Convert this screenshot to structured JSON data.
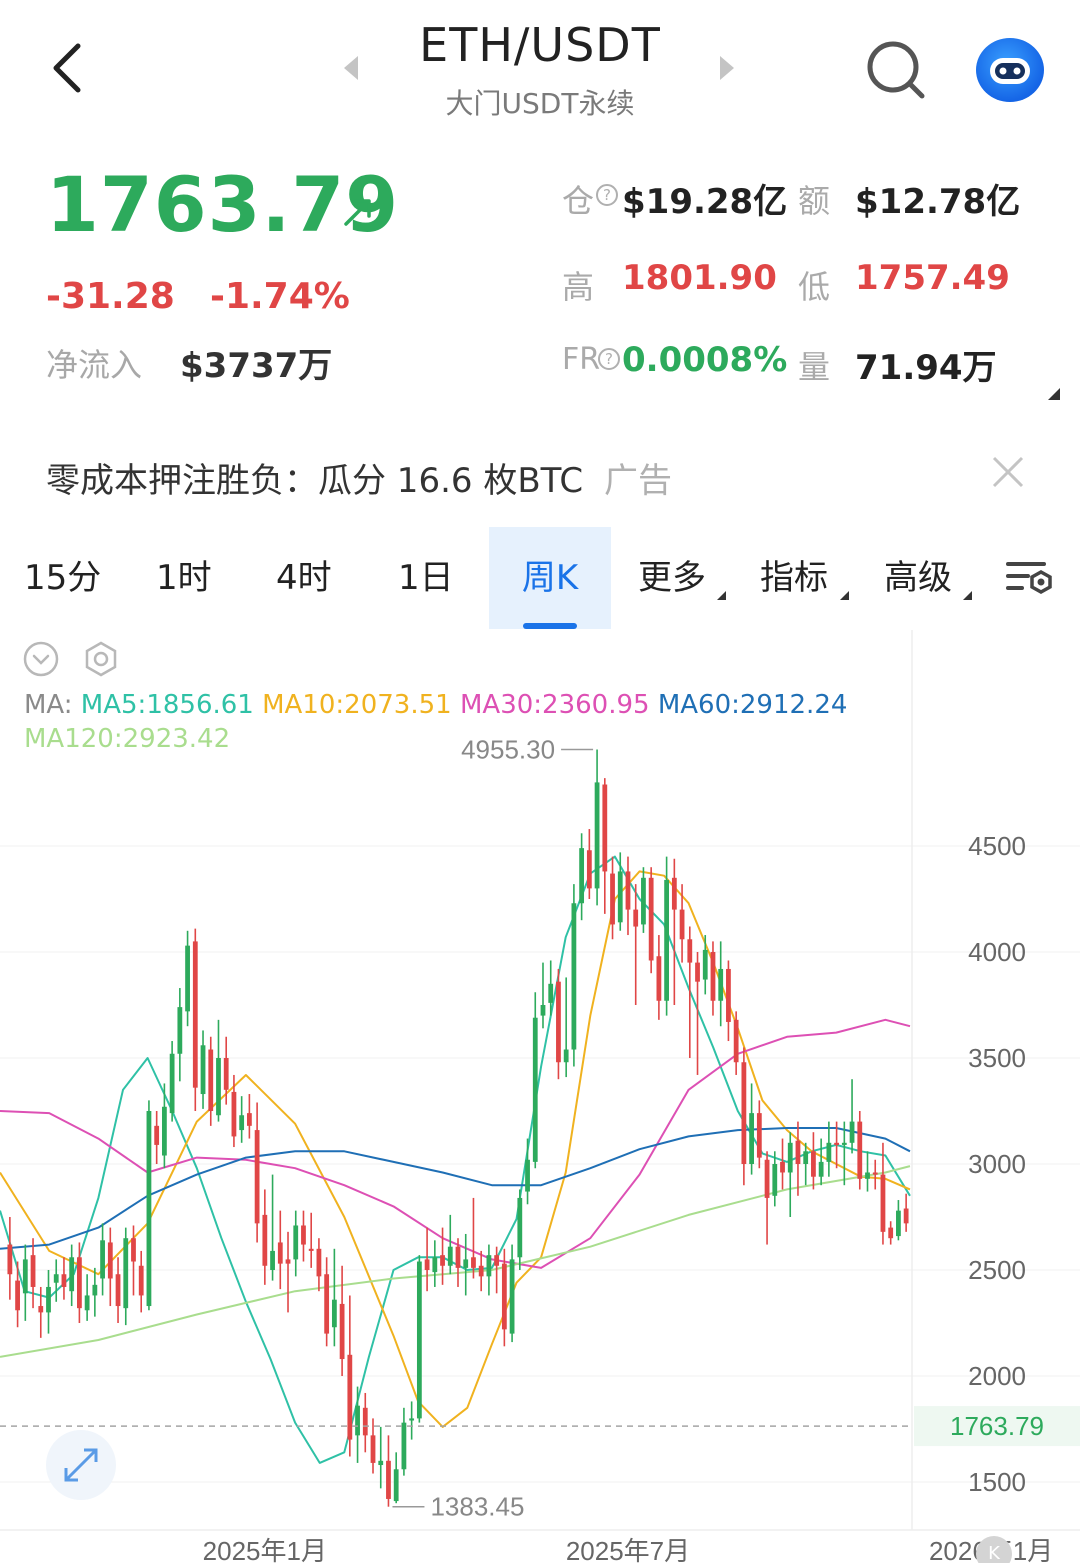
{
  "header": {
    "title": "ETH/USDT",
    "subtitle": "大门USDT永续"
  },
  "ticker": {
    "last_price": "1763.79",
    "change_abs": "-31.28",
    "change_pct": "-1.74%",
    "inflow_label": "净流入",
    "inflow_value": "$3737万"
  },
  "stats": {
    "open_interest_label": "仓",
    "open_interest_value": "$19.28亿",
    "turnover_label": "额",
    "turnover_value": "$12.78亿",
    "high_label": "高",
    "high_value": "1801.90",
    "low_label": "低",
    "low_value": "1757.49",
    "funding_label": "FR",
    "funding_value": "0.0008%",
    "volume_label": "量",
    "volume_value": "71.94万"
  },
  "ad": {
    "text": "零成本押注胜负：瓜分 16.6 枚BTC",
    "tag": "广告"
  },
  "tabs": [
    {
      "label": "15分"
    },
    {
      "label": "1时"
    },
    {
      "label": "4时"
    },
    {
      "label": "1日"
    },
    {
      "label": "周K",
      "active": true
    },
    {
      "label": "更多"
    },
    {
      "label": "指标"
    },
    {
      "label": "高级"
    }
  ],
  "indicators": {
    "prefix": "MA:",
    "ma5": "MA5:1856.61",
    "ma10": "MA10:2073.51",
    "ma30": "MA30:2360.95",
    "ma60": "MA60:2912.24",
    "ma120": "MA120:2923.42"
  },
  "colors": {
    "up": "#2daa5c",
    "down": "#e04646",
    "accent": "#1a73e8",
    "ma5": "#2fc1a6",
    "ma10": "#f0b21f",
    "ma30": "#dd50b4",
    "ma60": "#1f6fb5",
    "ma120": "#a9dd8e"
  },
  "chart_data": {
    "type": "candlestick",
    "y_ticks": [
      4500,
      4000,
      3500,
      3000,
      2500,
      2000,
      1500
    ],
    "ylim": [
      1300,
      5150
    ],
    "x_labels": [
      "2025年1月",
      "2025年7月",
      "2026年1月"
    ],
    "current_price": 1763.79,
    "max_label": "4955.30",
    "min_label": "1383.45",
    "candles": [
      {
        "o": 2620,
        "c": 2480,
        "h": 2750,
        "l": 2360
      },
      {
        "o": 2450,
        "c": 2310,
        "h": 2540,
        "l": 2230
      },
      {
        "o": 2390,
        "c": 2550,
        "h": 2620,
        "l": 2260
      },
      {
        "o": 2570,
        "c": 2420,
        "h": 2650,
        "l": 2320
      },
      {
        "o": 2330,
        "c": 2300,
        "h": 2420,
        "l": 2180
      },
      {
        "o": 2300,
        "c": 2420,
        "h": 2500,
        "l": 2200
      },
      {
        "o": 2440,
        "c": 2480,
        "h": 2550,
        "l": 2350
      },
      {
        "o": 2480,
        "c": 2420,
        "h": 2560,
        "l": 2360
      },
      {
        "o": 2400,
        "c": 2560,
        "h": 2620,
        "l": 2330
      },
      {
        "o": 2560,
        "c": 2320,
        "h": 2630,
        "l": 2250
      },
      {
        "o": 2310,
        "c": 2380,
        "h": 2480,
        "l": 2260
      },
      {
        "o": 2380,
        "c": 2430,
        "h": 2510,
        "l": 2280
      },
      {
        "o": 2460,
        "c": 2640,
        "h": 2720,
        "l": 2380
      },
      {
        "o": 2630,
        "c": 2460,
        "h": 2700,
        "l": 2330
      },
      {
        "o": 2480,
        "c": 2330,
        "h": 2560,
        "l": 2250
      },
      {
        "o": 2320,
        "c": 2650,
        "h": 2700,
        "l": 2240
      },
      {
        "o": 2650,
        "c": 2540,
        "h": 2710,
        "l": 2380
      },
      {
        "o": 2520,
        "c": 2380,
        "h": 2590,
        "l": 2300
      },
      {
        "o": 2330,
        "c": 3250,
        "h": 3300,
        "l": 2310
      },
      {
        "o": 3180,
        "c": 3090,
        "h": 3250,
        "l": 3000
      },
      {
        "o": 3040,
        "c": 3270,
        "h": 3380,
        "l": 2980
      },
      {
        "o": 3240,
        "c": 3520,
        "h": 3580,
        "l": 3200
      },
      {
        "o": 3520,
        "c": 3740,
        "h": 3830,
        "l": 3390
      },
      {
        "o": 3720,
        "c": 4030,
        "h": 4100,
        "l": 3650
      },
      {
        "o": 4050,
        "c": 3360,
        "h": 4110,
        "l": 3250
      },
      {
        "o": 3330,
        "c": 3560,
        "h": 3630,
        "l": 3260
      },
      {
        "o": 3540,
        "c": 3250,
        "h": 3600,
        "l": 3180
      },
      {
        "o": 3230,
        "c": 3500,
        "h": 3680,
        "l": 3200
      },
      {
        "o": 3500,
        "c": 3350,
        "h": 3600,
        "l": 3280
      },
      {
        "o": 3340,
        "c": 3130,
        "h": 3420,
        "l": 3080
      },
      {
        "o": 3160,
        "c": 3230,
        "h": 3320,
        "l": 3100
      },
      {
        "o": 3240,
        "c": 3180,
        "h": 3330,
        "l": 3120
      },
      {
        "o": 3160,
        "c": 2720,
        "h": 3290,
        "l": 2630
      },
      {
        "o": 2760,
        "c": 2520,
        "h": 2880,
        "l": 2430
      },
      {
        "o": 2500,
        "c": 2590,
        "h": 2950,
        "l": 2450
      },
      {
        "o": 2630,
        "c": 2530,
        "h": 2780,
        "l": 2410
      },
      {
        "o": 2550,
        "c": 2530,
        "h": 2680,
        "l": 2300
      },
      {
        "o": 2550,
        "c": 2710,
        "h": 2780,
        "l": 2470
      },
      {
        "o": 2710,
        "c": 2620,
        "h": 2780,
        "l": 2540
      },
      {
        "o": 2600,
        "c": 2590,
        "h": 2770,
        "l": 2510
      },
      {
        "o": 2600,
        "c": 2470,
        "h": 2650,
        "l": 2400
      },
      {
        "o": 2480,
        "c": 2200,
        "h": 2560,
        "l": 2140
      },
      {
        "o": 2230,
        "c": 2360,
        "h": 2600,
        "l": 2140
      },
      {
        "o": 2340,
        "c": 2080,
        "h": 2520,
        "l": 2000
      },
      {
        "o": 2100,
        "c": 1700,
        "h": 2380,
        "l": 1620
      },
      {
        "o": 1720,
        "c": 1860,
        "h": 1950,
        "l": 1590
      },
      {
        "o": 1850,
        "c": 1720,
        "h": 1920,
        "l": 1640
      },
      {
        "o": 1720,
        "c": 1590,
        "h": 1800,
        "l": 1540
      },
      {
        "o": 1580,
        "c": 1600,
        "h": 1760,
        "l": 1470
      },
      {
        "o": 1600,
        "c": 1420,
        "h": 1720,
        "l": 1383.45
      },
      {
        "o": 1410,
        "c": 1560,
        "h": 1640,
        "l": 1400
      },
      {
        "o": 1560,
        "c": 1780,
        "h": 1850,
        "l": 1530
      },
      {
        "o": 1790,
        "c": 1800,
        "h": 1880,
        "l": 1700
      },
      {
        "o": 1800,
        "c": 2540,
        "h": 2570,
        "l": 1780
      },
      {
        "o": 2550,
        "c": 2500,
        "h": 2700,
        "l": 2400
      },
      {
        "o": 2490,
        "c": 2560,
        "h": 2640,
        "l": 2420
      },
      {
        "o": 2570,
        "c": 2520,
        "h": 2700,
        "l": 2430
      },
      {
        "o": 2520,
        "c": 2610,
        "h": 2760,
        "l": 2480
      },
      {
        "o": 2610,
        "c": 2510,
        "h": 2650,
        "l": 2420
      },
      {
        "o": 2510,
        "c": 2550,
        "h": 2670,
        "l": 2380
      },
      {
        "o": 2560,
        "c": 2510,
        "h": 2840,
        "l": 2460
      },
      {
        "o": 2520,
        "c": 2470,
        "h": 2590,
        "l": 2400
      },
      {
        "o": 2470,
        "c": 2570,
        "h": 2620,
        "l": 2380
      },
      {
        "o": 2570,
        "c": 2520,
        "h": 2610,
        "l": 2390
      },
      {
        "o": 2530,
        "c": 2220,
        "h": 2600,
        "l": 2140
      },
      {
        "o": 2200,
        "c": 2550,
        "h": 2620,
        "l": 2160
      },
      {
        "o": 2560,
        "c": 2840,
        "h": 2880,
        "l": 2500
      },
      {
        "o": 2870,
        "c": 3020,
        "h": 3120,
        "l": 2810
      },
      {
        "o": 3010,
        "c": 3690,
        "h": 3810,
        "l": 2980
      },
      {
        "o": 3700,
        "c": 3750,
        "h": 3950,
        "l": 3640
      },
      {
        "o": 3760,
        "c": 3850,
        "h": 3960,
        "l": 3700
      },
      {
        "o": 3860,
        "c": 3480,
        "h": 3920,
        "l": 3400
      },
      {
        "o": 3480,
        "c": 3540,
        "h": 3880,
        "l": 3410
      },
      {
        "o": 3540,
        "c": 4230,
        "h": 4320,
        "l": 3460
      },
      {
        "o": 4230,
        "c": 4490,
        "h": 4560,
        "l": 4150
      },
      {
        "o": 4480,
        "c": 4300,
        "h": 4580,
        "l": 4250
      },
      {
        "o": 4300,
        "c": 4800,
        "h": 4955.3,
        "l": 4220
      },
      {
        "o": 4790,
        "c": 4380,
        "h": 4820,
        "l": 4180
      },
      {
        "o": 4370,
        "c": 4130,
        "h": 4450,
        "l": 4060
      },
      {
        "o": 4140,
        "c": 4380,
        "h": 4470,
        "l": 4100
      },
      {
        "o": 4380,
        "c": 4200,
        "h": 4450,
        "l": 4080
      },
      {
        "o": 4200,
        "c": 4120,
        "h": 4320,
        "l": 3750
      },
      {
        "o": 4130,
        "c": 4350,
        "h": 4400,
        "l": 4090
      },
      {
        "o": 4350,
        "c": 3960,
        "h": 4400,
        "l": 3900
      },
      {
        "o": 3980,
        "c": 3770,
        "h": 4080,
        "l": 3680
      },
      {
        "o": 3770,
        "c": 4340,
        "h": 4450,
        "l": 3700
      },
      {
        "o": 4350,
        "c": 4200,
        "h": 4440,
        "l": 3750
      },
      {
        "o": 4200,
        "c": 4060,
        "h": 4320,
        "l": 3950
      },
      {
        "o": 4060,
        "c": 3950,
        "h": 4120,
        "l": 3500
      },
      {
        "o": 3950,
        "c": 3860,
        "h": 4000,
        "l": 3420
      },
      {
        "o": 3870,
        "c": 4010,
        "h": 4080,
        "l": 3800
      },
      {
        "o": 4000,
        "c": 3770,
        "h": 4050,
        "l": 3700
      },
      {
        "o": 3770,
        "c": 3920,
        "h": 4050,
        "l": 3650
      },
      {
        "o": 3920,
        "c": 3670,
        "h": 3960,
        "l": 3580
      },
      {
        "o": 3680,
        "c": 3480,
        "h": 3720,
        "l": 3420
      },
      {
        "o": 3480,
        "c": 3000,
        "h": 3550,
        "l": 2900
      },
      {
        "o": 3000,
        "c": 3240,
        "h": 3380,
        "l": 2950
      },
      {
        "o": 3240,
        "c": 3030,
        "h": 3300,
        "l": 2980
      },
      {
        "o": 3020,
        "c": 2840,
        "h": 3060,
        "l": 2620
      },
      {
        "o": 2850,
        "c": 3000,
        "h": 3060,
        "l": 2800
      },
      {
        "o": 3010,
        "c": 2960,
        "h": 3120,
        "l": 2880
      },
      {
        "o": 2960,
        "c": 3100,
        "h": 3150,
        "l": 2750
      },
      {
        "o": 3110,
        "c": 3000,
        "h": 3200,
        "l": 2850
      },
      {
        "o": 3000,
        "c": 3060,
        "h": 3100,
        "l": 2900
      },
      {
        "o": 3060,
        "c": 2940,
        "h": 3150,
        "l": 2880
      },
      {
        "o": 2940,
        "c": 3010,
        "h": 3120,
        "l": 2900
      },
      {
        "o": 3010,
        "c": 3100,
        "h": 3200,
        "l": 2940
      },
      {
        "o": 3100,
        "c": 3090,
        "h": 3200,
        "l": 2980
      },
      {
        "o": 3090,
        "c": 3100,
        "h": 3200,
        "l": 2900
      },
      {
        "o": 3100,
        "c": 3200,
        "h": 3400,
        "l": 3050
      },
      {
        "o": 3200,
        "c": 2930,
        "h": 3250,
        "l": 2880
      },
      {
        "o": 2930,
        "c": 2960,
        "h": 3060,
        "l": 2870
      },
      {
        "o": 2960,
        "c": 2950,
        "h": 3020,
        "l": 2880
      },
      {
        "o": 2950,
        "c": 2680,
        "h": 3100,
        "l": 2620
      },
      {
        "o": 2700,
        "c": 2650,
        "h": 2730,
        "l": 2620
      },
      {
        "o": 2660,
        "c": 2780,
        "h": 2830,
        "l": 2640
      },
      {
        "o": 2790,
        "c": 2720,
        "h": 2860,
        "l": 2680
      }
    ],
    "ma_series": {
      "MA5": [
        [
          0,
          2780
        ],
        [
          5,
          2400
        ],
        [
          10,
          2370
        ],
        [
          15,
          2480
        ],
        [
          20,
          2840
        ],
        [
          25,
          3350
        ],
        [
          30,
          3500
        ],
        [
          35,
          3250
        ],
        [
          40,
          2980
        ],
        [
          45,
          2650
        ],
        [
          50,
          2350
        ],
        [
          55,
          2080
        ],
        [
          60,
          1780
        ],
        [
          65,
          1590
        ],
        [
          70,
          1640
        ],
        [
          75,
          2090
        ],
        [
          80,
          2500
        ],
        [
          85,
          2560
        ],
        [
          90,
          2560
        ],
        [
          95,
          2500
        ],
        [
          100,
          2510
        ],
        [
          105,
          2740
        ],
        [
          110,
          3460
        ],
        [
          115,
          4070
        ],
        [
          120,
          4370
        ],
        [
          125,
          4450
        ],
        [
          130,
          4250
        ],
        [
          135,
          4130
        ],
        [
          140,
          3830
        ],
        [
          145,
          3550
        ],
        [
          150,
          3250
        ],
        [
          155,
          3050
        ],
        [
          160,
          3010
        ],
        [
          165,
          3060
        ],
        [
          170,
          3090
        ],
        [
          175,
          3060
        ],
        [
          180,
          3040
        ],
        [
          185,
          2850
        ]
      ],
      "MA10": [
        [
          0,
          2960
        ],
        [
          10,
          2590
        ],
        [
          20,
          2480
        ],
        [
          30,
          2720
        ],
        [
          40,
          3200
        ],
        [
          50,
          3420
        ],
        [
          60,
          3190
        ],
        [
          70,
          2750
        ],
        [
          80,
          2190
        ],
        [
          85,
          1880
        ],
        [
          90,
          1760
        ],
        [
          95,
          1850
        ],
        [
          100,
          2150
        ],
        [
          105,
          2440
        ],
        [
          110,
          2560
        ],
        [
          115,
          2960
        ],
        [
          120,
          3700
        ],
        [
          125,
          4250
        ],
        [
          130,
          4380
        ],
        [
          135,
          4360
        ],
        [
          140,
          4230
        ],
        [
          145,
          3950
        ],
        [
          150,
          3640
        ],
        [
          155,
          3300
        ],
        [
          160,
          3160
        ],
        [
          165,
          3060
        ],
        [
          170,
          3000
        ],
        [
          175,
          2940
        ],
        [
          180,
          2930
        ],
        [
          185,
          2880
        ]
      ],
      "MA30": [
        [
          0,
          3250
        ],
        [
          10,
          3240
        ],
        [
          20,
          3120
        ],
        [
          30,
          2960
        ],
        [
          40,
          3030
        ],
        [
          50,
          3020
        ],
        [
          60,
          2980
        ],
        [
          70,
          2900
        ],
        [
          80,
          2800
        ],
        [
          90,
          2650
        ],
        [
          100,
          2550
        ],
        [
          110,
          2510
        ],
        [
          120,
          2650
        ],
        [
          130,
          2950
        ],
        [
          140,
          3350
        ],
        [
          150,
          3520
        ],
        [
          160,
          3600
        ],
        [
          170,
          3620
        ],
        [
          180,
          3680
        ],
        [
          185,
          3650
        ]
      ],
      "MA60": [
        [
          0,
          2600
        ],
        [
          10,
          2620
        ],
        [
          20,
          2700
        ],
        [
          30,
          2850
        ],
        [
          40,
          2950
        ],
        [
          50,
          3030
        ],
        [
          60,
          3060
        ],
        [
          70,
          3060
        ],
        [
          80,
          3010
        ],
        [
          90,
          2960
        ],
        [
          100,
          2900
        ],
        [
          110,
          2900
        ],
        [
          120,
          2980
        ],
        [
          130,
          3070
        ],
        [
          140,
          3130
        ],
        [
          150,
          3160
        ],
        [
          160,
          3170
        ],
        [
          170,
          3170
        ],
        [
          180,
          3120
        ],
        [
          185,
          3060
        ]
      ],
      "MA120": [
        [
          0,
          2090
        ],
        [
          20,
          2170
        ],
        [
          40,
          2290
        ],
        [
          60,
          2400
        ],
        [
          80,
          2460
        ],
        [
          100,
          2500
        ],
        [
          120,
          2610
        ],
        [
          140,
          2760
        ],
        [
          160,
          2880
        ],
        [
          180,
          2960
        ],
        [
          185,
          2990
        ]
      ]
    }
  }
}
